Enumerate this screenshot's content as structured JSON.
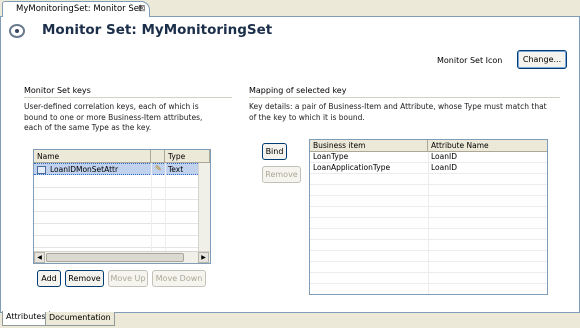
{
  "editor_tab": {
    "title": "MyMonitoringSet: Monitor Set",
    "close_glyph": "⊠"
  },
  "header": {
    "icon": "monitor-set-icon",
    "title": "Monitor Set: MyMonitoringSet"
  },
  "icon_section": {
    "label": "Monitor Set Icon",
    "change_button": "Change..."
  },
  "keys_section": {
    "title": "Monitor Set keys",
    "description_lines": [
      "User-defined correlation keys, each of which is",
      "bound to one or more Business-Item attributes,",
      "each of the same Type as the key."
    ],
    "table": {
      "columns": [
        "Name",
        "Type"
      ],
      "rows": [
        {
          "name": "LoanIDMonSetAttr",
          "type": "Text",
          "selected": true
        }
      ]
    },
    "buttons": {
      "add": "Add",
      "remove": "Remove",
      "move_up": "Move Up",
      "move_down": "Move Down"
    }
  },
  "mapping_section": {
    "title": "Mapping of selected key",
    "description_lines": [
      "Key details: a pair of Business-Item and Attribute, whose Type must match that",
      "of the key to which it is bound."
    ],
    "buttons": {
      "bind": "Bind",
      "remove": "Remove"
    },
    "table": {
      "columns": [
        "Business item",
        "Attribute Name"
      ],
      "rows": [
        {
          "business_item": "LoanType",
          "attribute": "LoanID"
        },
        {
          "business_item": "LoanApplicationType",
          "attribute": "LoanID"
        }
      ]
    }
  },
  "page_tabs": [
    "Attributes",
    "Documentation"
  ],
  "colors": {
    "title": "#1c2f4a",
    "selection": "#c1d2ee",
    "border": "#7f9db9"
  }
}
